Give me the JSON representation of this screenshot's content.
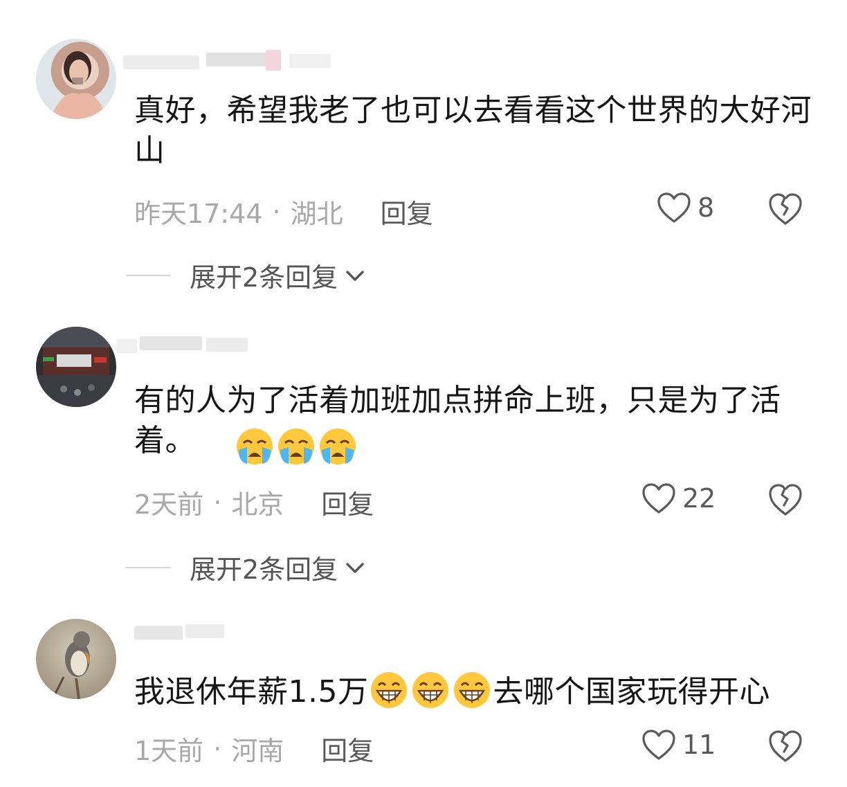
{
  "comments": [
    {
      "text": "真好，希望我老了也可以去看看这个世界的大好河山",
      "time": "昨天17:44",
      "location": "湖北",
      "reply_label": "回复",
      "likes": "8",
      "expand_label": "展开2条回复"
    },
    {
      "text": "有的人为了活着加班加点拼命上班，只是为了活着。",
      "time": "2天前",
      "location": "北京",
      "reply_label": "回复",
      "likes": "22",
      "expand_label": "展开2条回复"
    },
    {
      "text_before": "我退休年薪1.5万",
      "text_after": "去哪个国家玩得开心",
      "time": "1天前",
      "location": "河南",
      "reply_label": "回复",
      "likes": "11"
    }
  ],
  "separator": "·",
  "icons": {
    "like": "heart-outline-icon",
    "dislike": "broken-heart-icon",
    "expand": "chevron-down-icon",
    "emoji_cry": "loudly-crying-face-icon",
    "emoji_grin": "grinning-squinting-face-icon"
  },
  "colors": {
    "text": "#161616",
    "meta": "#a8a8a8",
    "action": "#595959",
    "emoji_yellow": "#ffc83d"
  }
}
